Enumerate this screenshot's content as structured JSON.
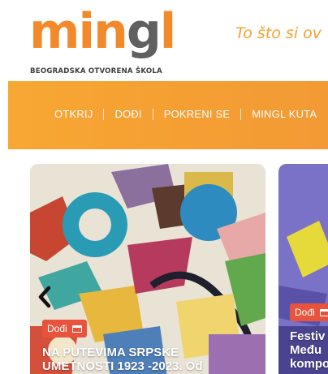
{
  "header": {
    "logo_word_1": "min",
    "logo_word_2": "g",
    "logo_word_3": "l",
    "logo_subtitle": "BEOGRADSKA OTVORENA ŠKOLA",
    "tagline": "To što si ov"
  },
  "nav": {
    "items": [
      "OTKRIJ",
      "DOĐI",
      "POKRENI SE",
      "MINGL KUTA"
    ]
  },
  "slider": {
    "cards": [
      {
        "badge": "Dođi",
        "title_line_1": "NA PUTEVIMA SRPSKE",
        "title_line_2": "UMETNOSTI 1923 -2023. Od"
      },
      {
        "badge": "Dođi",
        "title_line_1": "Festiv",
        "title_line_2": "Među",
        "title_line_3": "kompo"
      }
    ],
    "prev_icon": "chevron-left-icon",
    "badge_icon": "calendar-icon"
  },
  "colors": {
    "brand_orange": "#f28a2c",
    "nav_orange": "#f5a033",
    "badge_red": "#e8533d",
    "card_2_purple": "#7c73c8"
  }
}
